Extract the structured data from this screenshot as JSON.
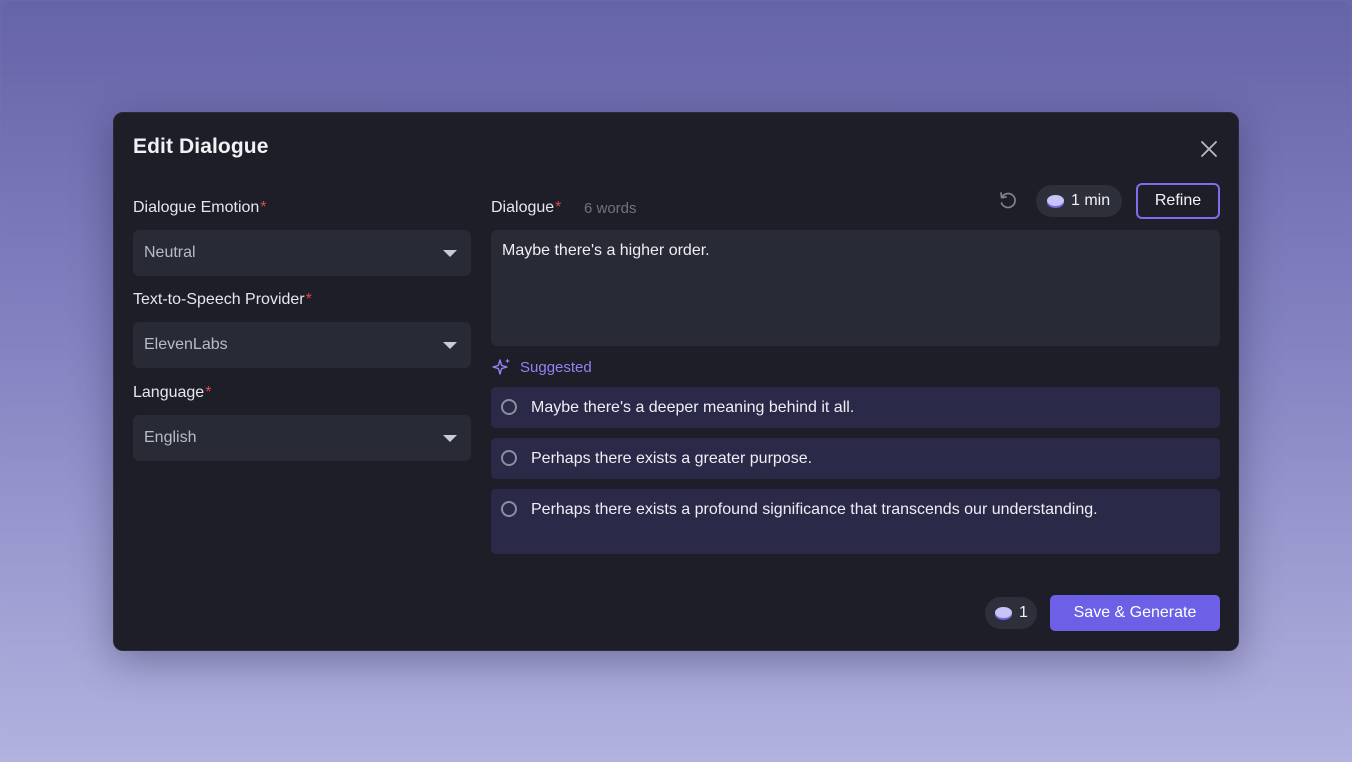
{
  "modal": {
    "title": "Edit Dialogue"
  },
  "left": {
    "emotion": {
      "label": "Dialogue Emotion",
      "required": "*",
      "value": "Neutral"
    },
    "provider": {
      "label": "Text-to-Speech Provider",
      "required": "*",
      "value": "ElevenLabs"
    },
    "language": {
      "label": "Language",
      "required": "*",
      "value": "English"
    }
  },
  "dialogue": {
    "label": "Dialogue",
    "required": "*",
    "word_count": "6 words",
    "duration": "1 min",
    "refine_label": "Refine",
    "text": "Maybe there's a higher order."
  },
  "suggested": {
    "label": "Suggested",
    "options": [
      "Maybe there's a deeper meaning behind it all.",
      "Perhaps there exists a greater purpose.",
      "Perhaps there exists a profound significance that transcends our understanding."
    ]
  },
  "footer": {
    "credits": "1",
    "save_label": "Save & Generate"
  },
  "colors": {
    "accent": "#6d5fe6",
    "modal_bg": "#1d1e27",
    "field_bg": "#282a36",
    "required": "#e0474c"
  },
  "icons": [
    "close-icon",
    "caret-down-icon",
    "undo-icon",
    "credit-coin-icon",
    "sparkle-icon",
    "radio-icon"
  ]
}
